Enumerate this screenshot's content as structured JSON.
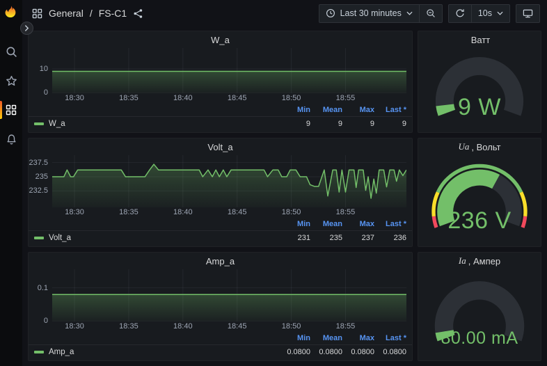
{
  "topbar": {
    "breadcrumb_section": "General",
    "breadcrumb_sep": "/",
    "breadcrumb_dashboard": "FS-C1",
    "time_range_label": "Last 30 minutes",
    "refresh_interval_label": "10s"
  },
  "legend": {
    "headers": [
      "Min",
      "Mean",
      "Max",
      "Last *"
    ]
  },
  "panels": {
    "w": {
      "title": "W_a",
      "series": "W_a",
      "values": {
        "min": "9",
        "mean": "9",
        "max": "9",
        "last": "9"
      }
    },
    "volt": {
      "title": "Volt_a",
      "series": "Volt_a",
      "values": {
        "min": "231",
        "mean": "235",
        "max": "237",
        "last": "236"
      }
    },
    "amp": {
      "title": "Amp_a",
      "series": "Amp_a",
      "values": {
        "min": "0.0800",
        "mean": "0.0800",
        "max": "0.0800",
        "last": "0.0800"
      }
    }
  },
  "gauges": {
    "watt": {
      "title_prefix": "",
      "title": "Ватт",
      "value": "9 W",
      "fraction": 0.06,
      "thresholds": []
    },
    "volt": {
      "title_prefix": "Ua",
      "title": ", Вольт",
      "value": "236 V",
      "fraction": 0.63,
      "thresholds": [
        {
          "color": "#F2495C",
          "from": 0,
          "to": 0.065
        },
        {
          "color": "#FADE2A",
          "from": 0.065,
          "to": 0.205
        },
        {
          "color": "#73BF69",
          "from": 0.205,
          "to": 0.795
        },
        {
          "color": "#FADE2A",
          "from": 0.795,
          "to": 0.935
        },
        {
          "color": "#F2495C",
          "from": 0.935,
          "to": 1
        }
      ]
    },
    "amp": {
      "title_prefix": "Ia",
      "title": ", Ампер",
      "value": "80.00 mA",
      "fraction": 0.05,
      "thresholds": []
    }
  },
  "colors": {
    "green": "#73BF69",
    "yellow": "#FADE2A",
    "red": "#F2495C",
    "blue": "#5794F2",
    "gauge_track": "#2c3036"
  },
  "chart_data": [
    {
      "id": "w",
      "type": "area",
      "title": "W_a",
      "xlabel": "",
      "ylabel": "",
      "ylim": [
        0,
        18.6
      ],
      "y_ticks": [
        {
          "label": "0",
          "value": 0
        },
        {
          "label": "10",
          "value": 10
        }
      ],
      "x_ticks": [
        {
          "label": "18:30",
          "frac": 0.063
        },
        {
          "label": "18:35",
          "frac": 0.216
        },
        {
          "label": "18:40",
          "frac": 0.369
        },
        {
          "label": "18:45",
          "frac": 0.522
        },
        {
          "label": "18:50",
          "frac": 0.675
        },
        {
          "label": "18:55",
          "frac": 0.828
        }
      ],
      "series": [
        {
          "name": "W_a",
          "color": "#73BF69",
          "points": [
            [
              0,
              9
            ],
            [
              1,
              9
            ]
          ],
          "stats": {
            "min": 9,
            "mean": 9,
            "max": 9,
            "last": 9
          }
        }
      ]
    },
    {
      "id": "volt",
      "type": "area",
      "title": "Volt_a",
      "xlabel": "",
      "ylabel": "",
      "ylim": [
        229.6,
        238.8
      ],
      "y_ticks": [
        {
          "label": "232.5",
          "value": 232.5
        },
        {
          "label": "235",
          "value": 235
        },
        {
          "label": "237.5",
          "value": 237.5
        }
      ],
      "x_ticks": [
        {
          "label": "18:30",
          "frac": 0.063
        },
        {
          "label": "18:35",
          "frac": 0.216
        },
        {
          "label": "18:40",
          "frac": 0.369
        },
        {
          "label": "18:45",
          "frac": 0.522
        },
        {
          "label": "18:50",
          "frac": 0.675
        },
        {
          "label": "18:55",
          "frac": 0.828
        }
      ],
      "series": [
        {
          "name": "Volt_a",
          "color": "#73BF69",
          "points": [
            [
              0,
              235
            ],
            [
              0.033,
              235
            ],
            [
              0.042,
              236.2
            ],
            [
              0.052,
              235
            ],
            [
              0.06,
              235
            ],
            [
              0.072,
              236.2
            ],
            [
              0.195,
              236.2
            ],
            [
              0.207,
              235
            ],
            [
              0.262,
              235
            ],
            [
              0.275,
              236.2
            ],
            [
              0.287,
              237.2
            ],
            [
              0.3,
              236.2
            ],
            [
              0.415,
              236.2
            ],
            [
              0.425,
              235
            ],
            [
              0.44,
              236.2
            ],
            [
              0.452,
              235
            ],
            [
              0.462,
              236.2
            ],
            [
              0.472,
              235
            ],
            [
              0.483,
              236.2
            ],
            [
              0.493,
              235
            ],
            [
              0.505,
              236.2
            ],
            [
              0.598,
              236.2
            ],
            [
              0.608,
              235
            ],
            [
              0.623,
              236.2
            ],
            [
              0.638,
              236.2
            ],
            [
              0.648,
              235
            ],
            [
              0.662,
              235
            ],
            [
              0.672,
              236.2
            ],
            [
              0.688,
              236.2
            ],
            [
              0.7,
              235
            ],
            [
              0.718,
              235
            ],
            [
              0.728,
              233.6
            ],
            [
              0.74,
              233.3
            ],
            [
              0.752,
              233.3
            ],
            [
              0.768,
              236.2
            ],
            [
              0.778,
              231.6
            ],
            [
              0.792,
              236.2
            ],
            [
              0.802,
              236.2
            ],
            [
              0.81,
              232.3
            ],
            [
              0.818,
              236.2
            ],
            [
              0.828,
              232.3
            ],
            [
              0.838,
              236.2
            ],
            [
              0.852,
              236.2
            ],
            [
              0.858,
              233.1
            ],
            [
              0.865,
              236.2
            ],
            [
              0.878,
              236.2
            ],
            [
              0.885,
              232.6
            ],
            [
              0.892,
              235
            ],
            [
              0.9,
              231.2
            ],
            [
              0.908,
              234.6
            ],
            [
              0.915,
              232.1
            ],
            [
              0.923,
              236.2
            ],
            [
              0.936,
              236.2
            ],
            [
              0.944,
              233.2
            ],
            [
              0.953,
              236.2
            ],
            [
              0.965,
              236.2
            ],
            [
              0.972,
              234.2
            ],
            [
              0.98,
              236.2
            ],
            [
              0.99,
              235.2
            ],
            [
              1,
              236.2
            ]
          ],
          "stats": {
            "min": 231,
            "mean": 235,
            "max": 237,
            "last": 236
          }
        }
      ]
    },
    {
      "id": "amp",
      "type": "area",
      "title": "Amp_a",
      "xlabel": "",
      "ylabel": "",
      "ylim": [
        0,
        0.155
      ],
      "y_ticks": [
        {
          "label": "0",
          "value": 0
        },
        {
          "label": "0.1",
          "value": 0.1
        }
      ],
      "x_ticks": [
        {
          "label": "18:30",
          "frac": 0.063
        },
        {
          "label": "18:35",
          "frac": 0.216
        },
        {
          "label": "18:40",
          "frac": 0.369
        },
        {
          "label": "18:45",
          "frac": 0.522
        },
        {
          "label": "18:50",
          "frac": 0.675
        },
        {
          "label": "18:55",
          "frac": 0.828
        }
      ],
      "series": [
        {
          "name": "Amp_a",
          "color": "#73BF69",
          "points": [
            [
              0,
              0.08
            ],
            [
              1,
              0.08
            ]
          ],
          "stats": {
            "min": 0.08,
            "mean": 0.08,
            "max": 0.08,
            "last": 0.08
          }
        }
      ]
    }
  ]
}
